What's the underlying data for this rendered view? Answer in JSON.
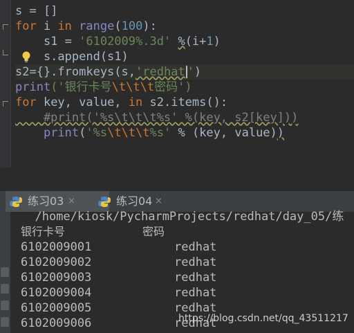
{
  "editor": {
    "lines": [
      {
        "parts": [
          "s = []"
        ]
      },
      {
        "parts": [
          "for",
          " i ",
          "in",
          " ",
          "range",
          "(",
          "100",
          "):"
        ]
      },
      {
        "parts": [
          "    s1 = ",
          "'6102009%.3d'",
          " ",
          "%",
          "(i+",
          "1",
          ")"
        ]
      },
      {
        "parts": [
          "    s.append(s1)"
        ]
      },
      {
        "parts": [
          "s2={}.fromkeys(s,",
          "'redhat",
          "'",
          ")"
        ]
      },
      {
        "parts": [
          "print",
          "('",
          "银行卡号",
          "\\t\\t\\t",
          "密码",
          "')"
        ]
      },
      {
        "parts": [
          "for",
          " key, value, ",
          "in",
          " s2.items():"
        ]
      },
      {
        "parts": [
          "    #print('%s\\t\\t\\t%s' %(key, s2[key]))"
        ]
      },
      {
        "parts": [
          "    ",
          "print",
          "(",
          "'%s",
          "\\t\\t\\t",
          "%s'",
          " % (key, value)",
          ")"
        ]
      }
    ]
  },
  "tabs": [
    {
      "label": "练习03",
      "close": "×"
    },
    {
      "label": "练习04",
      "close": "×"
    }
  ],
  "console": {
    "path": "  /home/kiosk/PycharmProjects/redhat/day_05/练",
    "header_card": "银行卡号",
    "header_pwd": "密码",
    "rows": [
      {
        "card": "6102009001",
        "pwd": "redhat"
      },
      {
        "card": "6102009002",
        "pwd": "redhat"
      },
      {
        "card": "6102009003",
        "pwd": "redhat"
      },
      {
        "card": "6102009004",
        "pwd": "redhat"
      },
      {
        "card": "6102009005",
        "pwd": "redhat"
      },
      {
        "card": "6102009006",
        "pwd": "redhat"
      }
    ]
  },
  "watermark": "https://blog.csdn.net/qq_43511217",
  "icons": {
    "bulb": "lightbulb-icon",
    "python": "python-icon",
    "close": "close-icon"
  }
}
